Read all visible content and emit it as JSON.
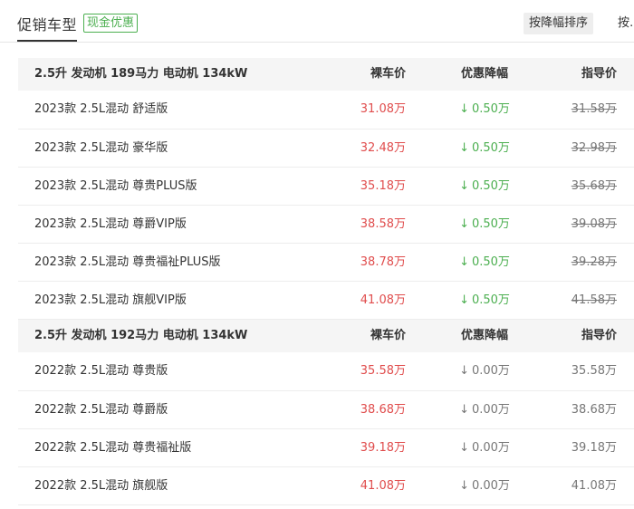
{
  "header": {
    "tab_title": "促销车型",
    "cash_badge": "现金优惠",
    "sort_discount": "按降幅排序",
    "sort_other": "按…"
  },
  "columns": {
    "price": "裸车价",
    "discount": "优惠降幅",
    "guide": "指导价"
  },
  "groups": [
    {
      "title": "2.5升 发动机 189马力 电动机 134kW",
      "rows": [
        {
          "name": "2023款 2.5L混动 舒适版",
          "price": "31.08万",
          "discount": "0.50万",
          "guide": "31.58万"
        },
        {
          "name": "2023款 2.5L混动 豪华版",
          "price": "32.48万",
          "discount": "0.50万",
          "guide": "32.98万"
        },
        {
          "name": "2023款 2.5L混动 尊贵PLUS版",
          "price": "35.18万",
          "discount": "0.50万",
          "guide": "35.68万"
        },
        {
          "name": "2023款 2.5L混动 尊爵VIP版",
          "price": "38.58万",
          "discount": "0.50万",
          "guide": "39.08万"
        },
        {
          "name": "2023款 2.5L混动 尊贵福祉PLUS版",
          "price": "38.78万",
          "discount": "0.50万",
          "guide": "39.28万"
        },
        {
          "name": "2023款 2.5L混动 旗舰VIP版",
          "price": "41.08万",
          "discount": "0.50万",
          "guide": "41.58万"
        }
      ]
    },
    {
      "title": "2.5升 发动机 192马力 电动机 134kW",
      "rows": [
        {
          "name": "2022款 2.5L混动 尊贵版",
          "price": "35.58万",
          "discount": "0.00万",
          "guide": "35.58万"
        },
        {
          "name": "2022款 2.5L混动 尊爵版",
          "price": "38.68万",
          "discount": "0.00万",
          "guide": "38.68万"
        },
        {
          "name": "2022款 2.5L混动 尊贵福祉版",
          "price": "39.18万",
          "discount": "0.00万",
          "guide": "39.18万"
        },
        {
          "name": "2022款 2.5L混动 旗舰版",
          "price": "41.08万",
          "discount": "0.00万",
          "guide": "41.08万"
        }
      ]
    }
  ],
  "colors": {
    "price": "#e04d4d",
    "discount_active": "#4caf50",
    "muted": "#777777"
  }
}
